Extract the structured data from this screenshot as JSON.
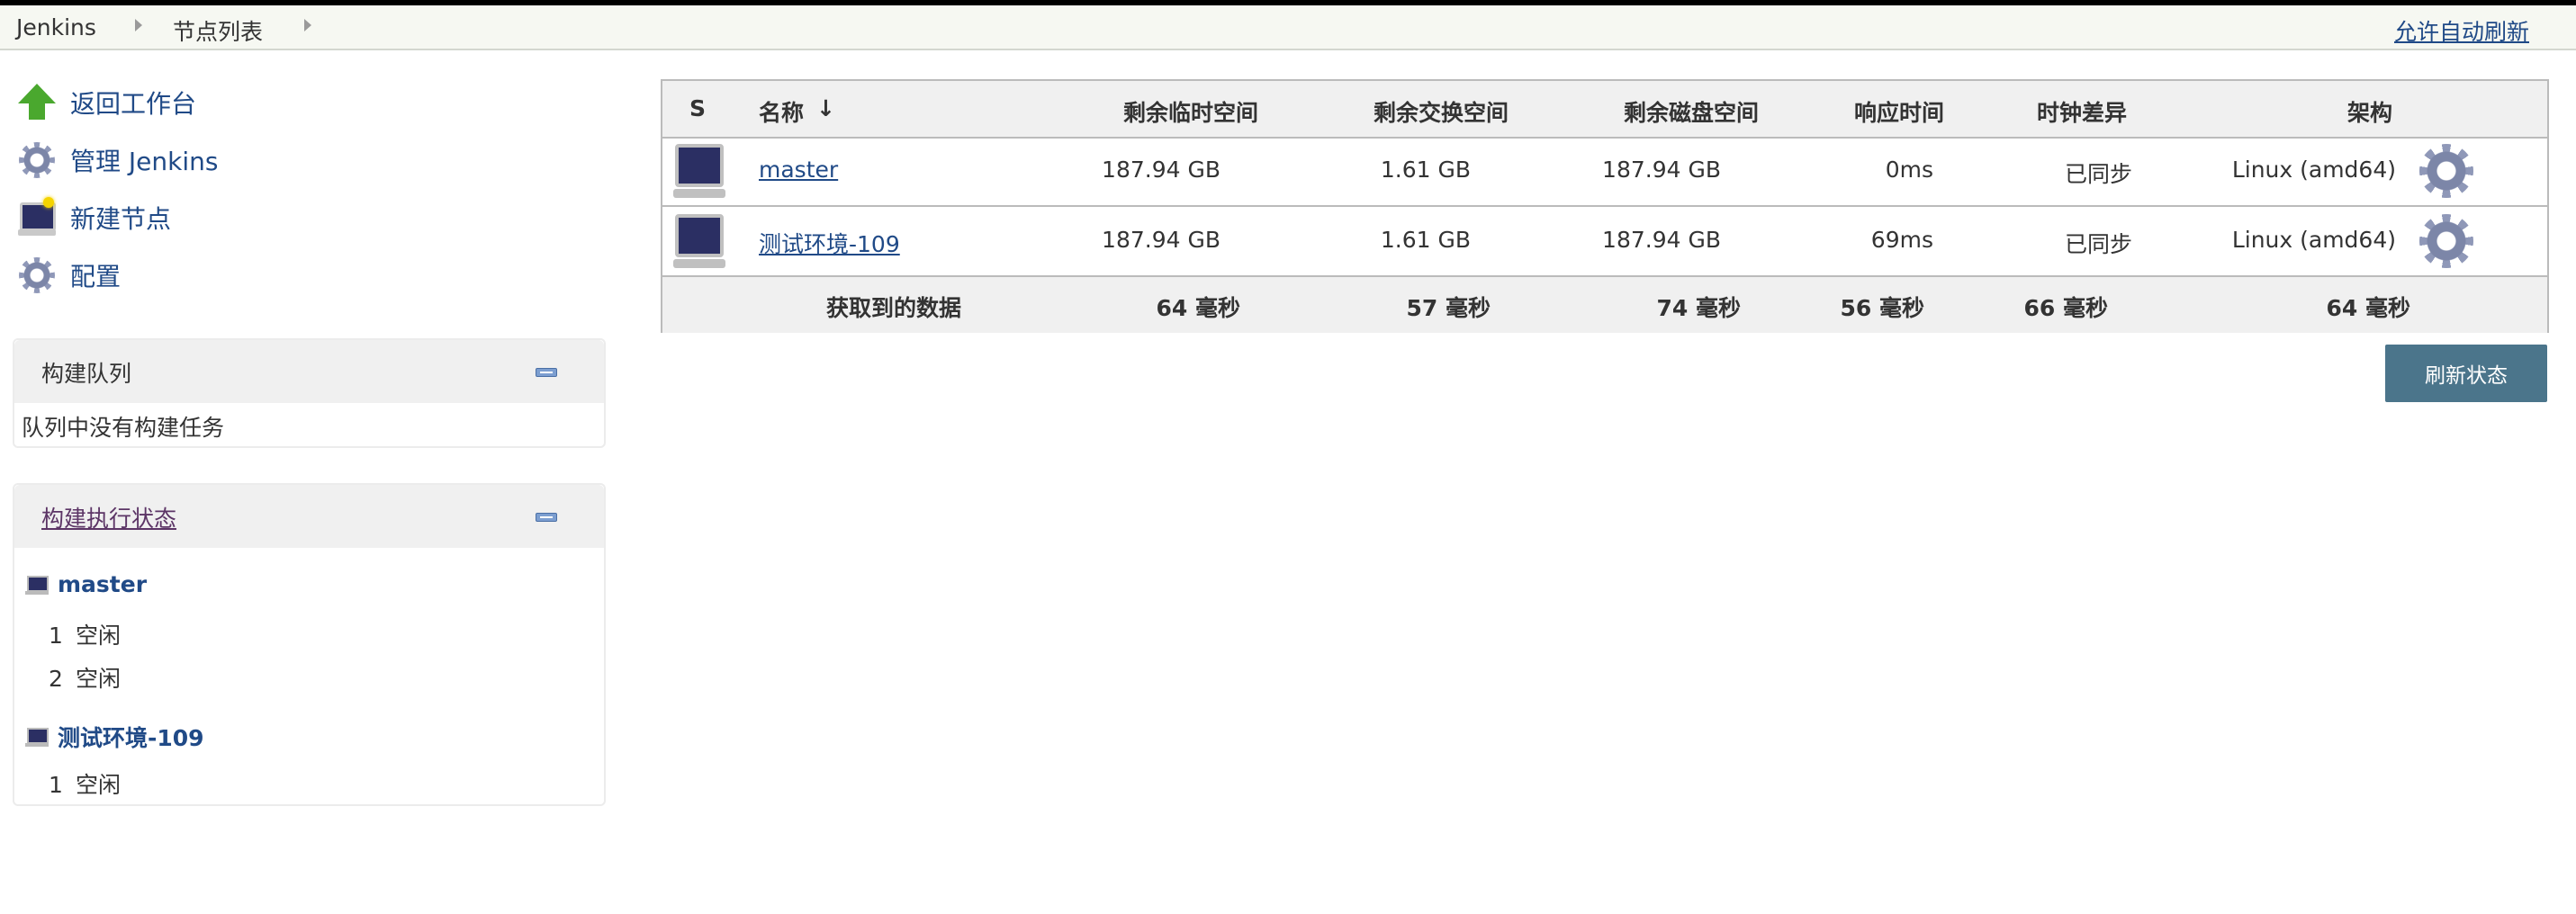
{
  "breadcrumb": {
    "items": [
      "Jenkins",
      "节点列表"
    ]
  },
  "header": {
    "autorefresh_label": "允许自动刷新"
  },
  "sidebar": {
    "tasks": [
      {
        "label": "返回工作台",
        "icon": "up-arrow-icon"
      },
      {
        "label": "管理 Jenkins",
        "icon": "gear-icon"
      },
      {
        "label": "新建节点",
        "icon": "new-computer-icon"
      },
      {
        "label": "配置",
        "icon": "gear-icon"
      }
    ],
    "build_queue": {
      "title": "构建队列",
      "empty_text": "队列中没有构建任务"
    },
    "executors": {
      "title": "构建执行状态",
      "nodes": [
        {
          "name": "master",
          "executors": [
            {
              "num": "1",
              "status": "空闲"
            },
            {
              "num": "2",
              "status": "空闲"
            }
          ]
        },
        {
          "name": "测试环境-109",
          "executors": [
            {
              "num": "1",
              "status": "空闲"
            }
          ]
        }
      ]
    }
  },
  "table": {
    "headers": [
      "S",
      "名称",
      "↓",
      "剩余临时空间",
      "剩余交换空间",
      "剩余磁盘空间",
      "响应时间",
      "时钟差异",
      "架构"
    ],
    "rows": [
      {
        "name": "master",
        "temp": "187.94 GB",
        "swap": "1.61 GB",
        "disk": "187.94 GB",
        "response": "0ms",
        "clock": "已同步",
        "arch": "Linux (amd64)"
      },
      {
        "name": "测试环境-109",
        "temp": "187.94 GB",
        "swap": "1.61 GB",
        "disk": "187.94 GB",
        "response": "69ms",
        "clock": "已同步",
        "arch": "Linux (amd64)"
      }
    ],
    "footer": {
      "label": "获取到的数据",
      "temp": "64 毫秒",
      "swap": "57 毫秒",
      "disk": "74 毫秒",
      "response": "56 毫秒",
      "clock": "66 毫秒",
      "arch": "64 毫秒"
    }
  },
  "refresh_button": "刷新状态",
  "colors": {
    "link": "#204a87",
    "button": "#4b758b",
    "header_bg": "#f0f0f0"
  }
}
